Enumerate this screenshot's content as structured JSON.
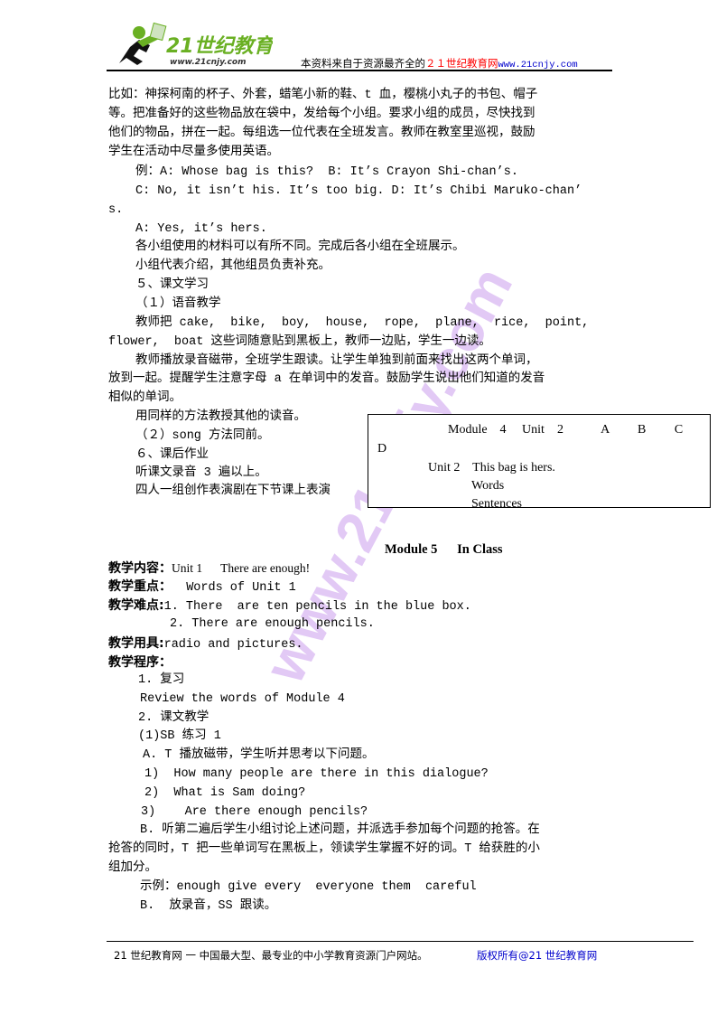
{
  "header": {
    "logo_text": "21世纪教育",
    "logo_url_text": "www.21cnjy.com",
    "tagline_prefix": "本资料来自于资源最齐全的",
    "tagline_brand": "２１世纪教育网",
    "tagline_url": "www.21cnjy.com",
    "brand_color": "#ff0000",
    "url_color": "#0000cc",
    "logo_green": "#6ab023"
  },
  "watermark": "www.21cnjy.com",
  "body": {
    "p1": [
      "比如：神探柯南的杯子、外套，蜡笔小新的鞋、t 血，樱桃小丸子的书包、帽子",
      "等。把准备好的这些物品放在袋中，发给每个小组。要求小组的成员，尽快找到",
      "他们的物品，拼在一起。每组选一位代表在全班发言。教师在教室里巡视，鼓励",
      "学生在活动中尽量多使用英语。"
    ],
    "ex1": "例：A: Whose bag is this?  B: It’s Crayon Shi-chan’s.",
    "ex2": "C: No, it isn’t his. It’s too big. D: It’s Chibi Maruko-chan’",
    "ex3": "s.",
    "ex4": "A: Yes, it’s hers.",
    "l1": "各小组使用的材料可以有所不同。完成后各小组在全班展示。",
    "l2": "小组代表介绍，其他组员负责补充。",
    "l3": "５、课文学习",
    "l4": "（１）语音教学",
    "l5": "教师把 cake,  bike,  boy,  house,  rope,  plane,  rice,  point,",
    "l6": "flower,  boat 这些词随意贴到黑板上，教师一边贴，学生一边读。",
    "l7": "教师播放录音磁带，全班学生跟读。让学生单独到前面来找出这两个单词，",
    "l8": "放到一起。提醒学生注意字母 a 在单词中的发音。鼓励学生说出他们知道的发音",
    "l9": "相似的单词。",
    "l10": "用同样的方法教授其他的读音。",
    "l11": "（２）song 方法同前。",
    "l12": "６、课后作业",
    "l13": "听课文录音 3 遍以上。",
    "l14": "四人一组创作表演剧在下节课上表演"
  },
  "box": {
    "line1": "Module    4     Unit    2            A         B         C",
    "line2": "D",
    "line3": "Unit 2    This bag is hers.",
    "line4": "Words",
    "line5": "Sentences"
  },
  "module5": {
    "title": "Module 5      In Class",
    "content_label": "教学内容：",
    "content_value": "Unit 1      There are enough!",
    "key_label": "教学重点：",
    "key_value": "  Words of Unit 1",
    "diff_label": "教学难点:",
    "diff_1": "1. There  are ten pencils in the blue box.",
    "diff_2": "2. There are enough pencils.",
    "tools_label": "教学用具:",
    "tools_value": "radio and pictures.",
    "proc_label": "教学程序：",
    "s1": "1. 复习",
    "s2": "Review the words of Module 4",
    "s3": "2. 课文教学",
    "s4": "(1)SB 练习 1",
    "s5": "A. T 播放磁带，学生听并思考以下问题。",
    "q1": "1)  How many people are there in this dialogue?",
    "q2": "2)  What is Sam doing?",
    "q3": "3)    Are there enough pencils?",
    "s6": "B. 听第二遍后学生小组讨论上述问题，并派选手参加每个问题的抢答。在",
    "s7": "抢答的同时，T 把一些单词写在黑板上，领读学生掌握不好的词。T 给获胜的小",
    "s8": "组加分。",
    "s9": "示例：enough give every  everyone them  careful",
    "s10": "B.  放录音，SS 跟读。"
  },
  "footer": {
    "left": "21 世纪教育网 一 中国最大型、最专业的中小学教育资源门户网站。",
    "right": "版权所有@21 世纪教育网",
    "right_color": "#0000cc"
  }
}
